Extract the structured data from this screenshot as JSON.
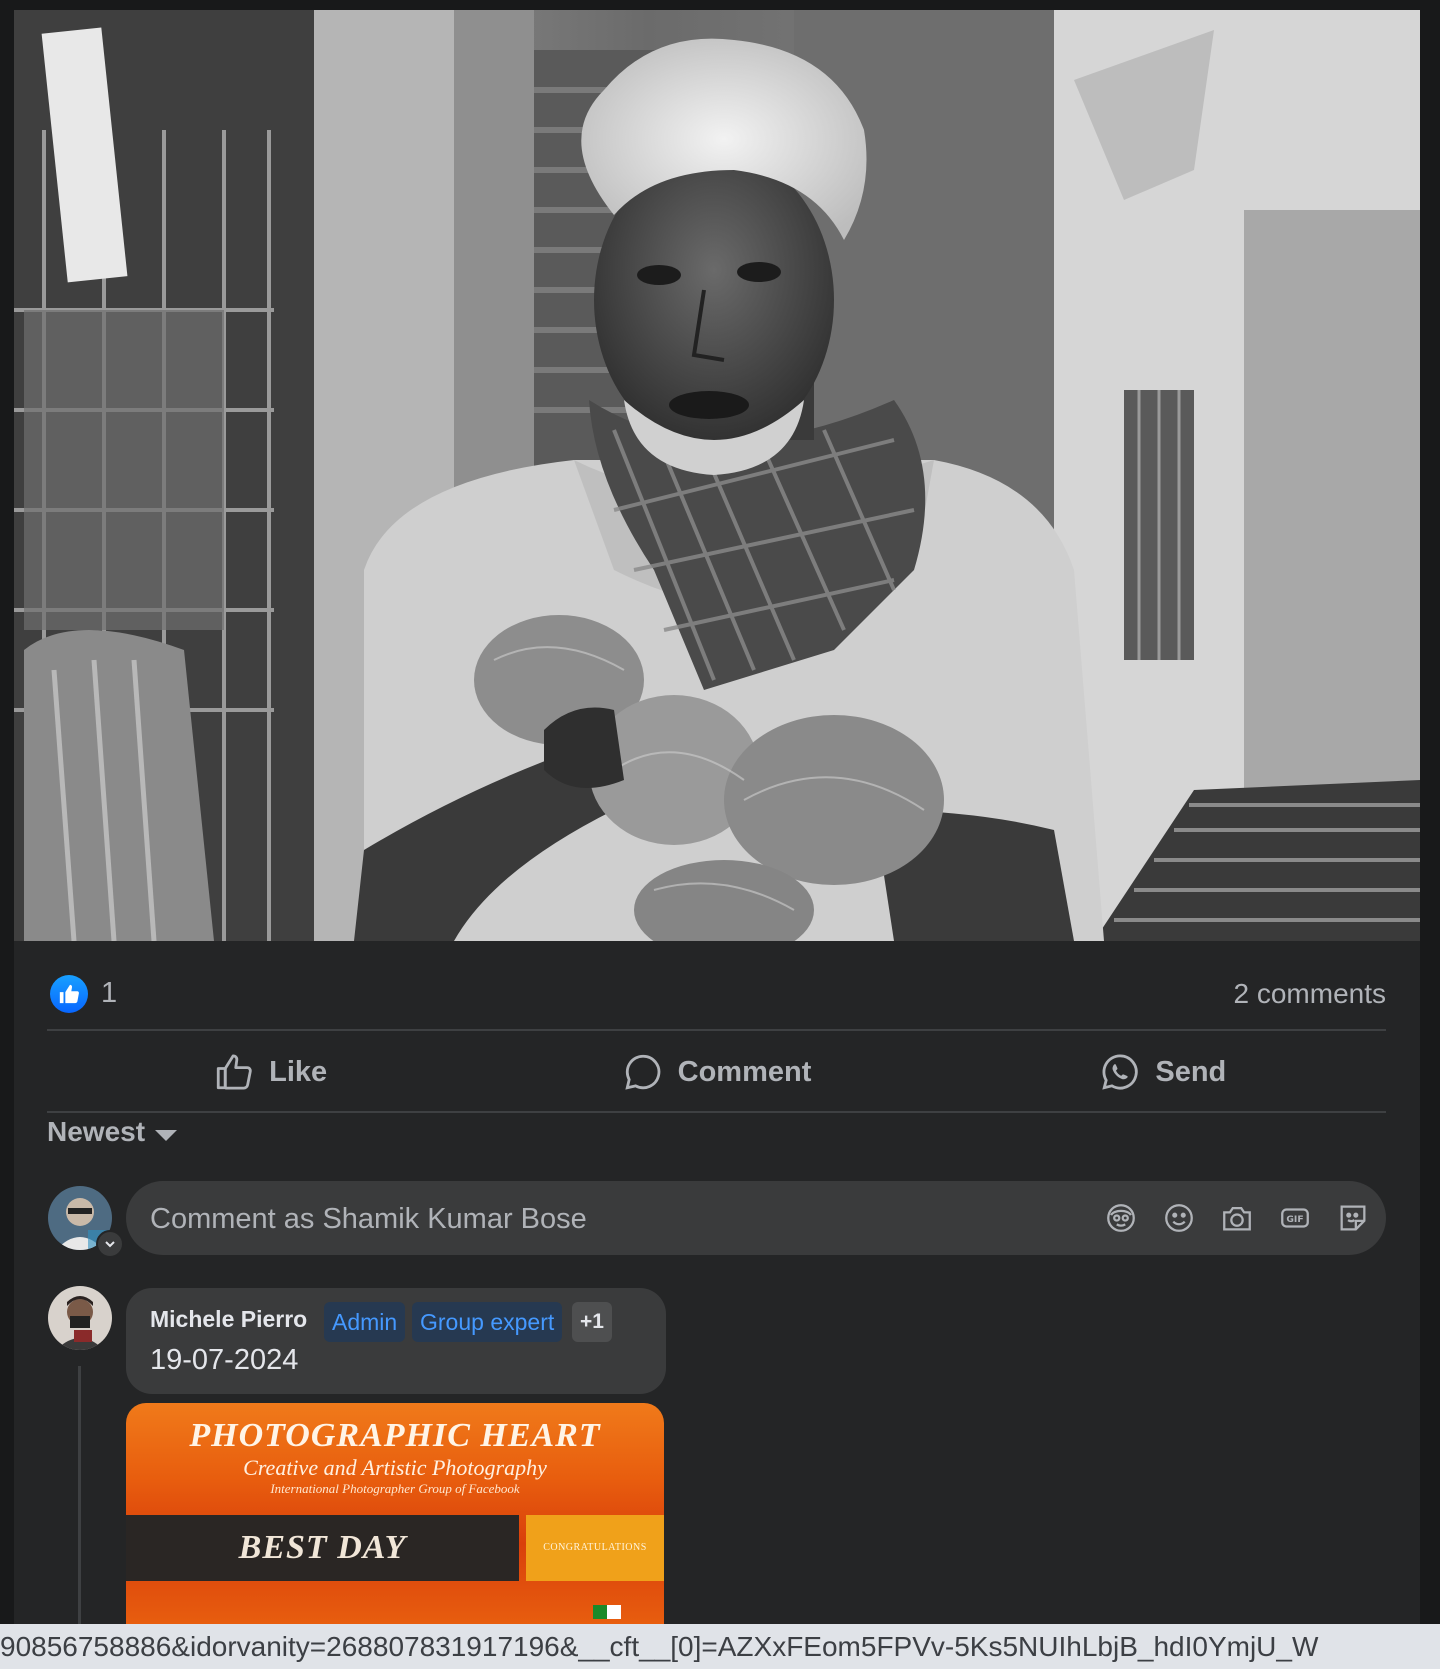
{
  "post": {
    "reaction_count": "1",
    "comments_count": "2 comments"
  },
  "actions": {
    "like_label": "Like",
    "comment_label": "Comment",
    "send_label": "Send"
  },
  "comments": {
    "sort_label": "Newest",
    "input_placeholder": "Comment as Shamik Kumar Bose",
    "items": [
      {
        "author": "Michele Pierro",
        "badges": [
          "Admin",
          "Group expert",
          "+1"
        ],
        "text": "19-07-2024",
        "attachment": {
          "title": "PHOTOGRAPHIC HEART",
          "subtitle": "Creative and Artistic Photography",
          "subtitle2": "International Photographer Group of Facebook",
          "band_text": "BEST DAY",
          "side_text": "CONGRATULATIONS"
        }
      }
    ]
  },
  "icons": {
    "like_badge": "thumbs-up-icon",
    "avatar_sticker": "avatar-sticker-icon",
    "emoji": "emoji-icon",
    "camera": "camera-icon",
    "gif": "gif-icon",
    "sticker": "sticker-icon"
  },
  "colors": {
    "background": "#18191a",
    "panel": "#242526",
    "accent": "#0866ff",
    "badge_text": "#4599ff"
  },
  "status_bar": {
    "url": "90856758886&idorvanity=268807831917196&__cft__[0]=AZXxFEom5FPVv-5Ks5NUIhLbjB_hdI0YmjU_W"
  }
}
